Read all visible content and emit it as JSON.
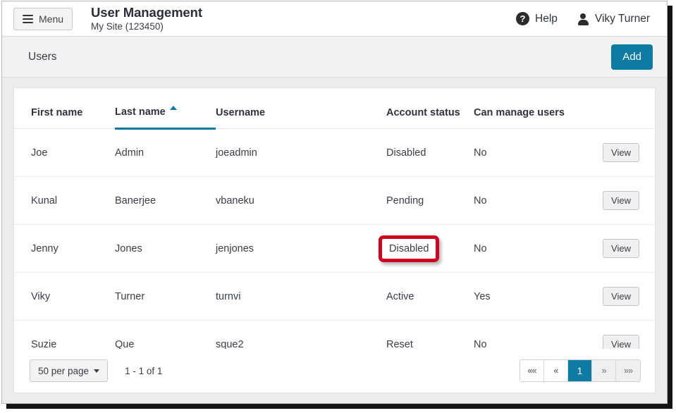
{
  "topbar": {
    "menu_label": "Menu",
    "title": "User Management",
    "subtitle": "My Site (123450)",
    "help_label": "Help",
    "help_glyph": "?",
    "user_label": "Viky Turner"
  },
  "subheader": {
    "title": "Users",
    "add_label": "Add"
  },
  "table": {
    "columns": [
      "First name",
      "Last name",
      "Username",
      "Account status",
      "Can manage users"
    ],
    "sorted_column": "Last name",
    "sort_direction": "ascending",
    "action_label": "View",
    "rows": [
      {
        "first_name": "Joe",
        "last_name": "Admin",
        "username": "joeadmin",
        "account_status": "Disabled",
        "can_manage_users": "No",
        "action": "View",
        "highlighted": false
      },
      {
        "first_name": "Kunal",
        "last_name": "Banerjee",
        "username": "vbaneku",
        "account_status": "Pending",
        "can_manage_users": "No",
        "action": "View",
        "highlighted": false
      },
      {
        "first_name": "Jenny",
        "last_name": "Jones",
        "username": "jenjones",
        "account_status": "Disabled",
        "can_manage_users": "No",
        "action": "View",
        "highlighted": true
      },
      {
        "first_name": "Viky",
        "last_name": "Turner",
        "username": "turnvi",
        "account_status": "Active",
        "can_manage_users": "Yes",
        "action": "View",
        "highlighted": false
      },
      {
        "first_name": "Suzie",
        "last_name": "Que",
        "username": "sque2",
        "account_status": "Reset",
        "can_manage_users": "No",
        "action": "View",
        "highlighted": false
      }
    ]
  },
  "footer": {
    "per_page_label": "50 per page",
    "range_text": "1 - 1 of 1",
    "pager": [
      {
        "label": "««",
        "name": "pagination-first",
        "state": "normal"
      },
      {
        "label": "«",
        "name": "pagination-previous",
        "state": "normal"
      },
      {
        "label": "1",
        "name": "pagination-page-1",
        "state": "active"
      },
      {
        "label": "»",
        "name": "pagination-next",
        "state": "muted"
      },
      {
        "label": "»»",
        "name": "pagination-last",
        "state": "muted"
      }
    ]
  },
  "colors": {
    "accent": "#0e7ba4",
    "highlight": "#d1001f",
    "page_background": "#ececec",
    "subheader_background": "#f2f2f2"
  }
}
